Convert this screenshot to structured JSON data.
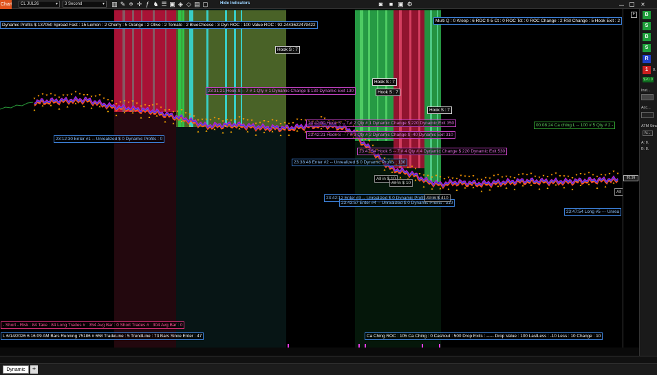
{
  "toolbar": {
    "chart_label": "Chart",
    "instrument": "CL JUL26",
    "interval": "3 Second",
    "hide_indicators": "Hide Indicators"
  },
  "overlays": {
    "top_left": "Dynamic Profits $  137050   Spread Fast :  15 Lemon :  2 Cherry :  5 Orange :  2 Olive :  2 Tomato :  2 BlueCheese :  3   Dyn ROC :  100 Value ROC :  92.2443622479422",
    "top_right": "Multi Q :  0  Kreep :  6  ROC 0-5 Ct :  0  ROC Tct :  0  ROC Change :  2    RSI Change :  5 Hook Exit :  2",
    "hook1": "Hook S : 7",
    "hook2": "Hook S : 7",
    "hook3": "Hook S : 7",
    "hook4": "Hook S : 7",
    "trade1": "23:31:21 Hook S   -- 7 # 1 Qty # 1 Dynamic Change $ 130 Dynamic Exit  130",
    "trade2": "23:42:00 Hook S   -- 7 # 2 Qty # 1 Dynamic Change $ 220 Dynamic Exit  350",
    "trade3": "23:42:21 Hook S   -- 7 # 3 Qty # 2 Dynamic Change $  -40 Dynamic Exit  310",
    "trade4": "23:47:54 Hook S   -- 7 # 4 Qty # 4 Dynamic Change $ 220 Dynamic Exit  530",
    "enter1": "23:12:30 Enter #1 -- Unrealized $  0  Dynamic Profits :  0",
    "enter2": "23:38:48 Enter #2 -- Unrealized $  0  Dynamic Profits :  130",
    "enter3": "23:42:12 Enter #3 -- Unrealized $  0  Dynamic Profits :  350",
    "enter4": "23:43:57 Enter #4 -- Unrealized $  0  Dynamic Profits :  310",
    "caching": "00:08:24 Ca ching L  -- 100 # 5 Qty # 2 - ",
    "long5": "23:47:54 Long #5 --- Unrea",
    "allin1": "All in $  10",
    "allin2": "All in $  10",
    "allin3": "All in $  410",
    "allin_right": "All",
    "short_stats": "- Short -   Risk :  84   Take :  84   Long Trades # :  354   Avg Bar :  0     Short Trades # :  304  Avg Bar :  0",
    "status": "L 6/14/2026 6:16:09 AM     Bars Running  75186  # 658    TradeLine :  5 TrendLine :  73  Bars Since Enter :  47",
    "caching_stats": "Ca Ching ROC :  105   Ca Ching :  0    Cashout :  500   Drop Exits :  -----     Drop Value :  100     LastLess :  -10     Less :  10     Change :  10"
  },
  "axis": {
    "price_tag": "91.16",
    "f_button": "F"
  },
  "panel": {
    "btn_b1": "B",
    "btn_s1": "S",
    "btn_b2": "B",
    "btn_s2": "S",
    "btn_r": "R",
    "qty_value": "1",
    "qty_suffix": "8.",
    "pnl": "$20.0",
    "inst_label": "Inst...",
    "acc_label": "Acc...",
    "atm_label": "ATM Stra",
    "n_value": "N...",
    "a_label": "A: 8.",
    "b_label": "B: 8."
  },
  "bottom": {
    "tab_label": "Dynamic",
    "add_label": "+"
  },
  "colors": {
    "red_band": "#c0143c",
    "cyan_band": "#36e0e0",
    "green_band": "#2aa84a",
    "olive_band": "#55702a",
    "panel_green": "#1e9e3a",
    "panel_red": "#cc1f1f",
    "panel_blue": "#2040c8"
  }
}
